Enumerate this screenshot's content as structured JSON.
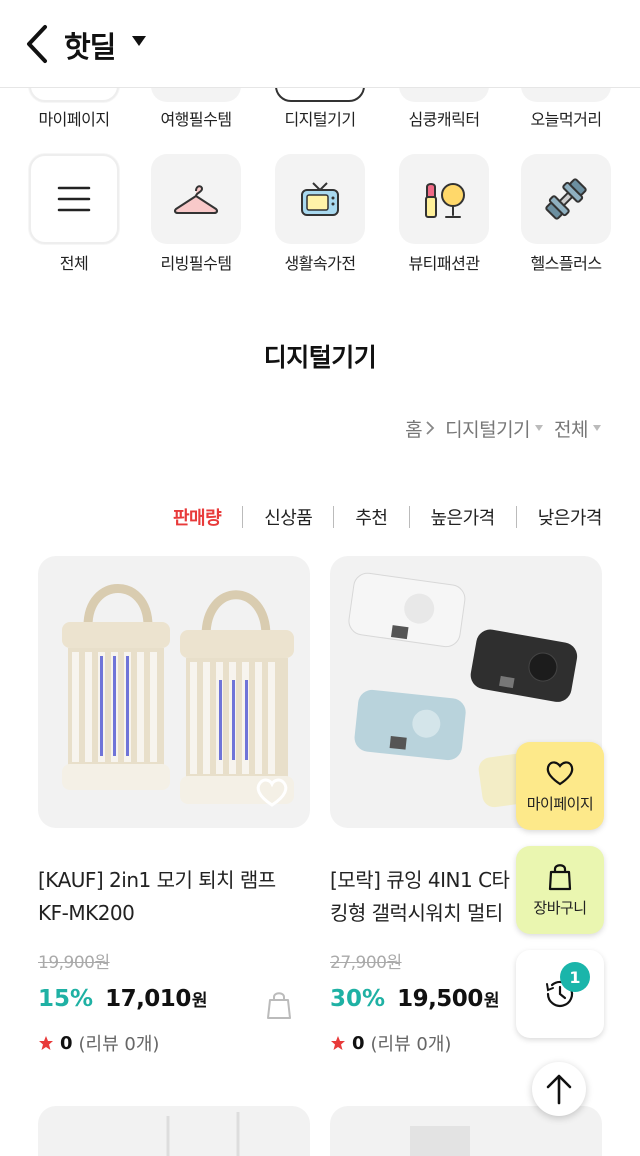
{
  "header": {
    "title": "핫딜"
  },
  "categories_row1": [
    {
      "label": "마이페이지",
      "icon": "mypage-icon"
    },
    {
      "label": "여행필수템",
      "icon": "travel-icon"
    },
    {
      "label": "디지털기기",
      "icon": "digital-icon",
      "active": true
    },
    {
      "label": "심쿵캐릭터",
      "icon": "character-icon"
    },
    {
      "label": "오늘먹거리",
      "icon": "food-icon"
    }
  ],
  "categories_row2": [
    {
      "label": "전체",
      "icon": "menu-icon"
    },
    {
      "label": "리빙필수템",
      "icon": "hanger-icon"
    },
    {
      "label": "생활속가전",
      "icon": "tv-icon"
    },
    {
      "label": "뷰티패션관",
      "icon": "beauty-icon"
    },
    {
      "label": "헬스플러스",
      "icon": "dumbbell-icon"
    }
  ],
  "section_title": "디지털기기",
  "breadcrumb": [
    "홈",
    "디지털기기",
    "전체"
  ],
  "sort_tabs": [
    "판매량",
    "신상품",
    "추천",
    "높은가격",
    "낮은가격"
  ],
  "products": [
    {
      "name": "[KAUF] 2in1 모기 퇴치 램프 KF-MK200",
      "original_price": "19,900원",
      "discount": "15%",
      "price": "17,010",
      "won": "원",
      "rating": "0",
      "reviews": "(리뷰 0개)"
    },
    {
      "name": "[모락] 큐잉 4IN1 C타 킹형 갤럭시워치 멀티",
      "original_price": "27,900원",
      "discount": "30%",
      "price": "19,500",
      "won": "원",
      "rating": "0",
      "reviews": "(리뷰 0개)"
    }
  ],
  "floating": {
    "mypage": "마이페이지",
    "cart": "장바구니",
    "recent_count": "1"
  },
  "colors": {
    "accent_red": "#e83a3a",
    "discount_teal": "#1fb1a4",
    "fab_yellow": "#fde98a",
    "fab_lime": "#eaf6b0",
    "badge_teal": "#1ab5aa"
  }
}
